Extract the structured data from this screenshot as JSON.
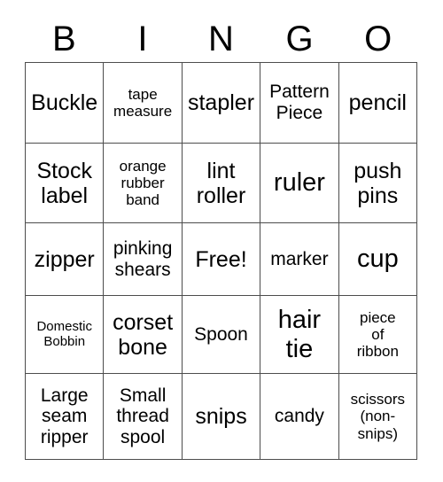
{
  "card": {
    "title": "BINGO",
    "header_letters": [
      "B",
      "I",
      "N",
      "G",
      "O"
    ],
    "border_color": "#4d4d4d",
    "background_color": "#ffffff",
    "text_color": "#000000",
    "columns": 5,
    "rows": 5,
    "free_space": "Free!"
  },
  "grid": {
    "rows": [
      {
        "cells": [
          {
            "text": "Buckle",
            "size": "fs-l"
          },
          {
            "text": "tape\nmeasure",
            "size": "fs-s"
          },
          {
            "text": "stapler",
            "size": "fs-l"
          },
          {
            "text": "Pattern\nPiece",
            "size": "fs-m"
          },
          {
            "text": "pencil",
            "size": "fs-l"
          }
        ]
      },
      {
        "cells": [
          {
            "text": "Stock\nlabel",
            "size": "fs-l"
          },
          {
            "text": "orange\nrubber\nband",
            "size": "fs-s"
          },
          {
            "text": "lint\nroller",
            "size": "fs-l"
          },
          {
            "text": "ruler",
            "size": "fs-xl"
          },
          {
            "text": "push\npins",
            "size": "fs-l"
          }
        ]
      },
      {
        "cells": [
          {
            "text": "zipper",
            "size": "fs-l"
          },
          {
            "text": "pinking\nshears",
            "size": "fs-m"
          },
          {
            "text": "Free!",
            "size": "fs-l"
          },
          {
            "text": "marker",
            "size": "fs-m"
          },
          {
            "text": "cup",
            "size": "fs-xl"
          }
        ]
      },
      {
        "cells": [
          {
            "text": "Domestic\nBobbin",
            "size": "fs-xs"
          },
          {
            "text": "corset\nbone",
            "size": "fs-l"
          },
          {
            "text": "Spoon",
            "size": "fs-m"
          },
          {
            "text": "hair\ntie",
            "size": "fs-xl"
          },
          {
            "text": "piece\nof\nribbon",
            "size": "fs-s"
          }
        ]
      },
      {
        "cells": [
          {
            "text": "Large\nseam\nripper",
            "size": "fs-m"
          },
          {
            "text": "Small\nthread\nspool",
            "size": "fs-m"
          },
          {
            "text": "snips",
            "size": "fs-l"
          },
          {
            "text": "candy",
            "size": "fs-m"
          },
          {
            "text": "scissors\n(non-\nsnips)",
            "size": "fs-s"
          }
        ]
      }
    ]
  }
}
